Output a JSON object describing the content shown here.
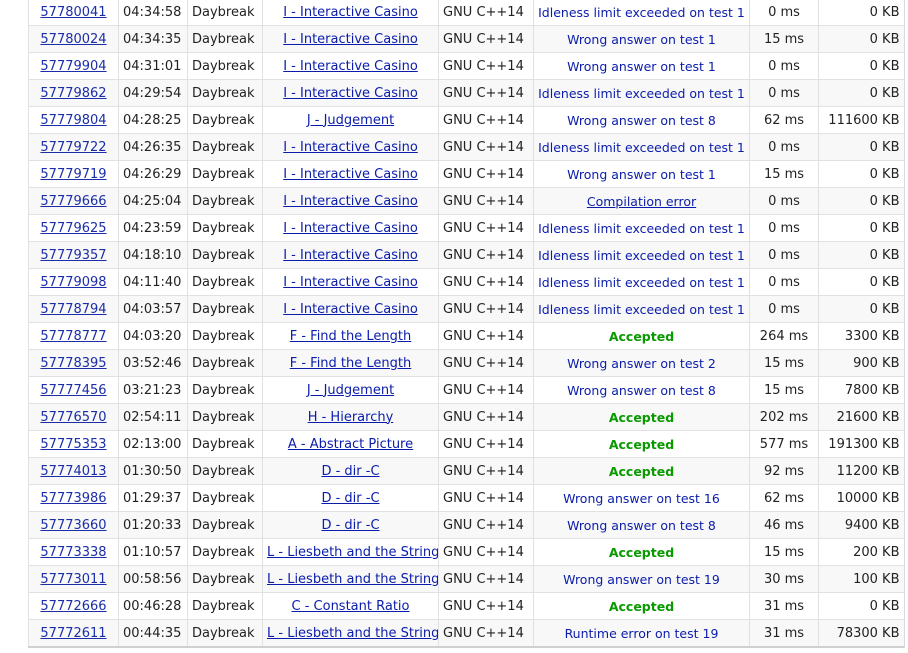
{
  "submissions": [
    {
      "id": "57780041",
      "when": "04:34:58",
      "who": "Daybreak",
      "problem": "I - Interactive Casino",
      "lang": "GNU C++14",
      "verdict": "Idleness limit exceeded on test 1",
      "verdict_type": "other",
      "time": "0 ms",
      "memory": "0 KB"
    },
    {
      "id": "57780024",
      "when": "04:34:35",
      "who": "Daybreak",
      "problem": "I - Interactive Casino",
      "lang": "GNU C++14",
      "verdict": "Wrong answer on test 1",
      "verdict_type": "other",
      "time": "15 ms",
      "memory": "0 KB"
    },
    {
      "id": "57779904",
      "when": "04:31:01",
      "who": "Daybreak",
      "problem": "I - Interactive Casino",
      "lang": "GNU C++14",
      "verdict": "Wrong answer on test 1",
      "verdict_type": "other",
      "time": "0 ms",
      "memory": "0 KB"
    },
    {
      "id": "57779862",
      "when": "04:29:54",
      "who": "Daybreak",
      "problem": "I - Interactive Casino",
      "lang": "GNU C++14",
      "verdict": "Idleness limit exceeded on test 1",
      "verdict_type": "other",
      "time": "0 ms",
      "memory": "0 KB"
    },
    {
      "id": "57779804",
      "when": "04:28:25",
      "who": "Daybreak",
      "problem": "J - Judgement",
      "lang": "GNU C++14",
      "verdict": "Wrong answer on test 8",
      "verdict_type": "other",
      "time": "62 ms",
      "memory": "111600 KB"
    },
    {
      "id": "57779722",
      "when": "04:26:35",
      "who": "Daybreak",
      "problem": "I - Interactive Casino",
      "lang": "GNU C++14",
      "verdict": "Idleness limit exceeded on test 1",
      "verdict_type": "other",
      "time": "0 ms",
      "memory": "0 KB"
    },
    {
      "id": "57779719",
      "when": "04:26:29",
      "who": "Daybreak",
      "problem": "I - Interactive Casino",
      "lang": "GNU C++14",
      "verdict": "Wrong answer on test 1",
      "verdict_type": "other",
      "time": "15 ms",
      "memory": "0 KB"
    },
    {
      "id": "57779666",
      "when": "04:25:04",
      "who": "Daybreak",
      "problem": "I - Interactive Casino",
      "lang": "GNU C++14",
      "verdict": "Compilation error",
      "verdict_type": "compile",
      "time": "0 ms",
      "memory": "0 KB"
    },
    {
      "id": "57779625",
      "when": "04:23:59",
      "who": "Daybreak",
      "problem": "I - Interactive Casino",
      "lang": "GNU C++14",
      "verdict": "Idleness limit exceeded on test 1",
      "verdict_type": "other",
      "time": "0 ms",
      "memory": "0 KB"
    },
    {
      "id": "57779357",
      "when": "04:18:10",
      "who": "Daybreak",
      "problem": "I - Interactive Casino",
      "lang": "GNU C++14",
      "verdict": "Idleness limit exceeded on test 1",
      "verdict_type": "other",
      "time": "0 ms",
      "memory": "0 KB"
    },
    {
      "id": "57779098",
      "when": "04:11:40",
      "who": "Daybreak",
      "problem": "I - Interactive Casino",
      "lang": "GNU C++14",
      "verdict": "Idleness limit exceeded on test 1",
      "verdict_type": "other",
      "time": "0 ms",
      "memory": "0 KB"
    },
    {
      "id": "57778794",
      "when": "04:03:57",
      "who": "Daybreak",
      "problem": "I - Interactive Casino",
      "lang": "GNU C++14",
      "verdict": "Idleness limit exceeded on test 1",
      "verdict_type": "other",
      "time": "0 ms",
      "memory": "0 KB"
    },
    {
      "id": "57778777",
      "when": "04:03:20",
      "who": "Daybreak",
      "problem": "F - Find the Length",
      "lang": "GNU C++14",
      "verdict": "Accepted",
      "verdict_type": "accepted",
      "time": "264 ms",
      "memory": "3300 KB"
    },
    {
      "id": "57778395",
      "when": "03:52:46",
      "who": "Daybreak",
      "problem": "F - Find the Length",
      "lang": "GNU C++14",
      "verdict": "Wrong answer on test 2",
      "verdict_type": "other",
      "time": "15 ms",
      "memory": "900 KB"
    },
    {
      "id": "57777456",
      "when": "03:21:23",
      "who": "Daybreak",
      "problem": "J - Judgement",
      "lang": "GNU C++14",
      "verdict": "Wrong answer on test 8",
      "verdict_type": "other",
      "time": "15 ms",
      "memory": "7800 KB"
    },
    {
      "id": "57776570",
      "when": "02:54:11",
      "who": "Daybreak",
      "problem": "H - Hierarchy",
      "lang": "GNU C++14",
      "verdict": "Accepted",
      "verdict_type": "accepted",
      "time": "202 ms",
      "memory": "21600 KB"
    },
    {
      "id": "57775353",
      "when": "02:13:00",
      "who": "Daybreak",
      "problem": "A - Abstract Picture",
      "lang": "GNU C++14",
      "verdict": "Accepted",
      "verdict_type": "accepted",
      "time": "577 ms",
      "memory": "191300 KB"
    },
    {
      "id": "57774013",
      "when": "01:30:50",
      "who": "Daybreak",
      "problem": "D - dir -C",
      "lang": "GNU C++14",
      "verdict": "Accepted",
      "verdict_type": "accepted",
      "time": "92 ms",
      "memory": "11200 KB"
    },
    {
      "id": "57773986",
      "when": "01:29:37",
      "who": "Daybreak",
      "problem": "D - dir -C",
      "lang": "GNU C++14",
      "verdict": "Wrong answer on test 16",
      "verdict_type": "other",
      "time": "62 ms",
      "memory": "10000 KB"
    },
    {
      "id": "57773660",
      "when": "01:20:33",
      "who": "Daybreak",
      "problem": "D - dir -C",
      "lang": "GNU C++14",
      "verdict": "Wrong answer on test 8",
      "verdict_type": "other",
      "time": "46 ms",
      "memory": "9400 KB"
    },
    {
      "id": "57773338",
      "when": "01:10:57",
      "who": "Daybreak",
      "problem": "L - Liesbeth and the String",
      "lang": "GNU C++14",
      "verdict": "Accepted",
      "verdict_type": "accepted",
      "time": "15 ms",
      "memory": "200 KB"
    },
    {
      "id": "57773011",
      "when": "00:58:56",
      "who": "Daybreak",
      "problem": "L - Liesbeth and the String",
      "lang": "GNU C++14",
      "verdict": "Wrong answer on test 19",
      "verdict_type": "other",
      "time": "30 ms",
      "memory": "100 KB"
    },
    {
      "id": "57772666",
      "when": "00:46:28",
      "who": "Daybreak",
      "problem": "C - Constant Ratio",
      "lang": "GNU C++14",
      "verdict": "Accepted",
      "verdict_type": "accepted",
      "time": "31 ms",
      "memory": "0 KB"
    },
    {
      "id": "57772611",
      "when": "00:44:35",
      "who": "Daybreak",
      "problem": "L - Liesbeth and the String",
      "lang": "GNU C++14",
      "verdict": "Runtime error on test 19",
      "verdict_type": "other",
      "time": "31 ms",
      "memory": "78300 KB"
    }
  ],
  "colors": {
    "link": "#0a1cab",
    "accepted": "#0a9900",
    "row_alt": "#f8f8f8",
    "border": "#e1e1e1"
  }
}
